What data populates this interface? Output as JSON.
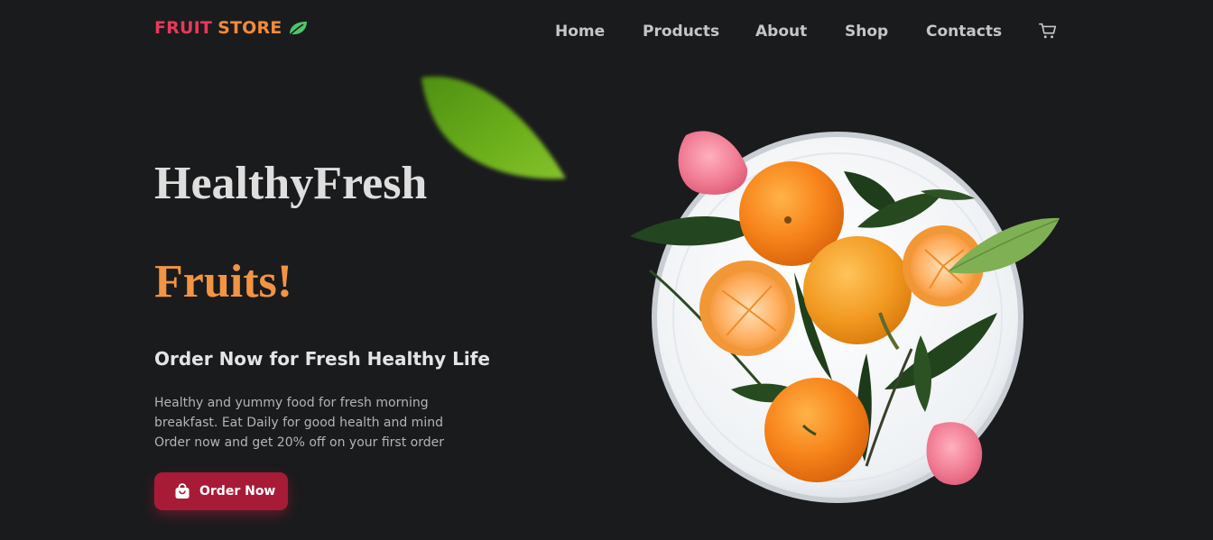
{
  "header": {
    "logo": {
      "word1": "FRUIT",
      "word2": "STORE",
      "icon": "leaf-icon"
    },
    "nav": [
      "Home",
      "Products",
      "About",
      "Shop",
      "Contacts"
    ],
    "cart_icon": "shopping-cart-icon"
  },
  "hero": {
    "title_line1": "HealthyFresh",
    "title_line2": "Fruits!",
    "subtitle": "Order Now for Fresh Healthy Life",
    "description_lines": [
      "Healthy and yummy food for fresh morning",
      "breakfast. Eat Daily for good health and mind",
      "Order now and get 20% off on your first order"
    ],
    "cta": {
      "label": "Order Now",
      "icon": "shopping-bag-icon"
    }
  },
  "colors": {
    "background": "#1a1b1d",
    "logo_red": "#e8395a",
    "logo_orange": "#f28b3c",
    "accent_orange": "#f39443",
    "button": "#a81b37",
    "leaf_green": "#4caf50"
  }
}
